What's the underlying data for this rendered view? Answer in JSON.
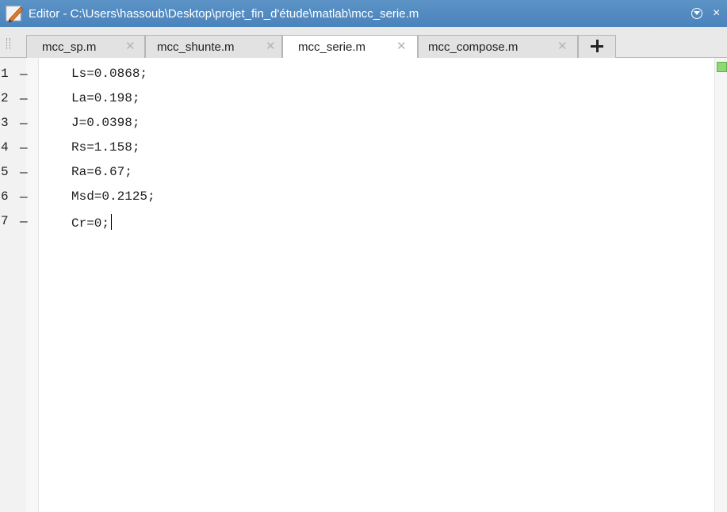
{
  "window": {
    "title": "Editor - C:\\Users\\hassoub\\Desktop\\projet_fin_d'étude\\matlab\\mcc_serie.m",
    "icon": "edit-pencil-icon",
    "menu_icon": "circle-chevron-down-icon",
    "close_glyph": "×"
  },
  "tabs": [
    {
      "label": "mcc_sp.m",
      "close": "✕",
      "active": false
    },
    {
      "label": "mcc_shunte.m",
      "close": "✕",
      "active": false
    },
    {
      "label": "mcc_serie.m",
      "close": "✕",
      "active": true
    },
    {
      "label": "mcc_compose.m",
      "close": "✕",
      "active": false
    }
  ],
  "new_tab_icon": "plus-icon",
  "code_lines": [
    {
      "num": "1",
      "marker": "—",
      "text": "Ls=0.0868;"
    },
    {
      "num": "2",
      "marker": "—",
      "text": "La=0.198;"
    },
    {
      "num": "3",
      "marker": "—",
      "text": "J=0.0398;"
    },
    {
      "num": "4",
      "marker": "—",
      "text": "Rs=1.158;"
    },
    {
      "num": "5",
      "marker": "—",
      "text": "Ra=6.67;"
    },
    {
      "num": "6",
      "marker": "—",
      "text": "Msd=0.2125;"
    },
    {
      "num": "7",
      "marker": "—",
      "text": "Cr=0;"
    }
  ],
  "colors": {
    "titlebar": "#4a84bc",
    "status_ok": "#8fd873"
  }
}
